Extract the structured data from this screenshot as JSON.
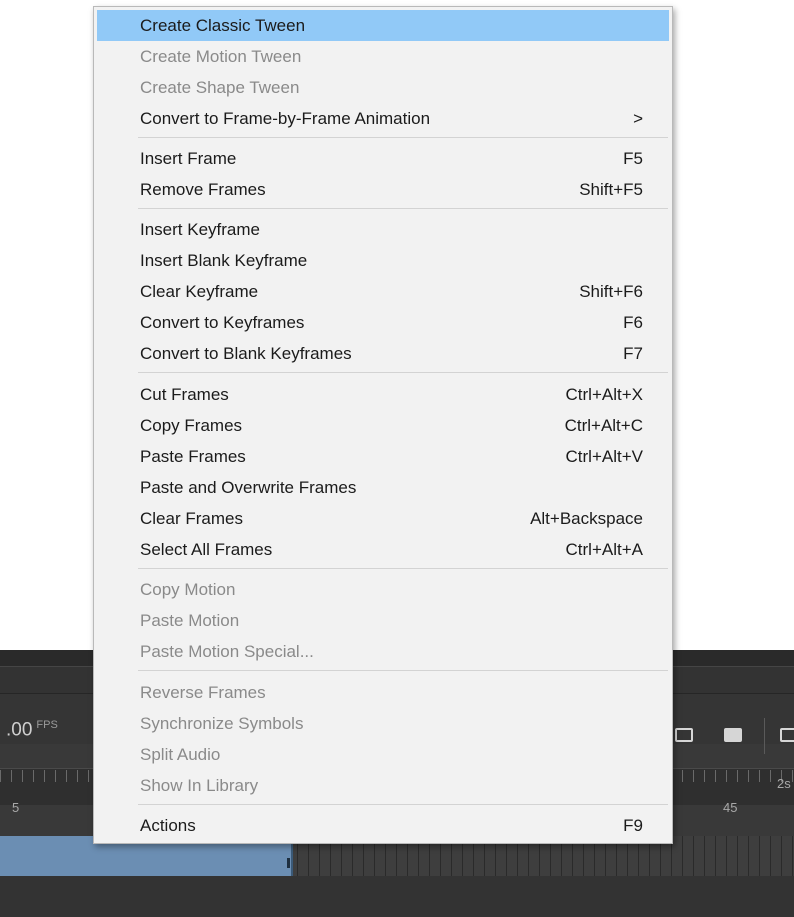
{
  "timeline": {
    "fps_value": ".00",
    "fps_unit": "FPS",
    "ruler_labels": {
      "left": "5",
      "mid": "45",
      "right": "2s"
    }
  },
  "menu": {
    "submenu_glyph": ">",
    "items": [
      {
        "label": "Create Classic Tween",
        "shortcut": "",
        "enabled": true,
        "highlighted": true
      },
      {
        "label": "Create Motion Tween",
        "shortcut": "",
        "enabled": false
      },
      {
        "label": "Create Shape Tween",
        "shortcut": "",
        "enabled": false
      },
      {
        "label": "Convert to Frame-by-Frame Animation",
        "shortcut": "",
        "enabled": true,
        "submenu": true
      },
      {
        "label": "Insert Frame",
        "shortcut": "F5",
        "enabled": true
      },
      {
        "label": "Remove Frames",
        "shortcut": "Shift+F5",
        "enabled": true
      },
      {
        "label": "Insert Keyframe",
        "shortcut": "",
        "enabled": true
      },
      {
        "label": "Insert Blank Keyframe",
        "shortcut": "",
        "enabled": true
      },
      {
        "label": "Clear Keyframe",
        "shortcut": "Shift+F6",
        "enabled": true
      },
      {
        "label": "Convert to Keyframes",
        "shortcut": "F6",
        "enabled": true
      },
      {
        "label": "Convert to Blank Keyframes",
        "shortcut": "F7",
        "enabled": true
      },
      {
        "label": "Cut Frames",
        "shortcut": "Ctrl+Alt+X",
        "enabled": true
      },
      {
        "label": "Copy Frames",
        "shortcut": "Ctrl+Alt+C",
        "enabled": true
      },
      {
        "label": "Paste Frames",
        "shortcut": "Ctrl+Alt+V",
        "enabled": true
      },
      {
        "label": "Paste and Overwrite Frames",
        "shortcut": "",
        "enabled": true
      },
      {
        "label": "Clear Frames",
        "shortcut": "Alt+Backspace",
        "enabled": true
      },
      {
        "label": "Select All Frames",
        "shortcut": "Ctrl+Alt+A",
        "enabled": true
      },
      {
        "label": "Copy Motion",
        "shortcut": "",
        "enabled": false
      },
      {
        "label": "Paste Motion",
        "shortcut": "",
        "enabled": false
      },
      {
        "label": "Paste Motion Special...",
        "shortcut": "",
        "enabled": false
      },
      {
        "label": "Reverse Frames",
        "shortcut": "",
        "enabled": false
      },
      {
        "label": "Synchronize Symbols",
        "shortcut": "",
        "enabled": false
      },
      {
        "label": "Split Audio",
        "shortcut": "",
        "enabled": false
      },
      {
        "label": "Show In Library",
        "shortcut": "",
        "enabled": false
      },
      {
        "label": "Actions",
        "shortcut": "F9",
        "enabled": true
      }
    ]
  },
  "colors": {
    "highlight": "#91c9f7",
    "menu_bg": "#f2f2f2",
    "disabled_text": "#8a8a8a",
    "timeline_selection": "#6b8eb3"
  }
}
